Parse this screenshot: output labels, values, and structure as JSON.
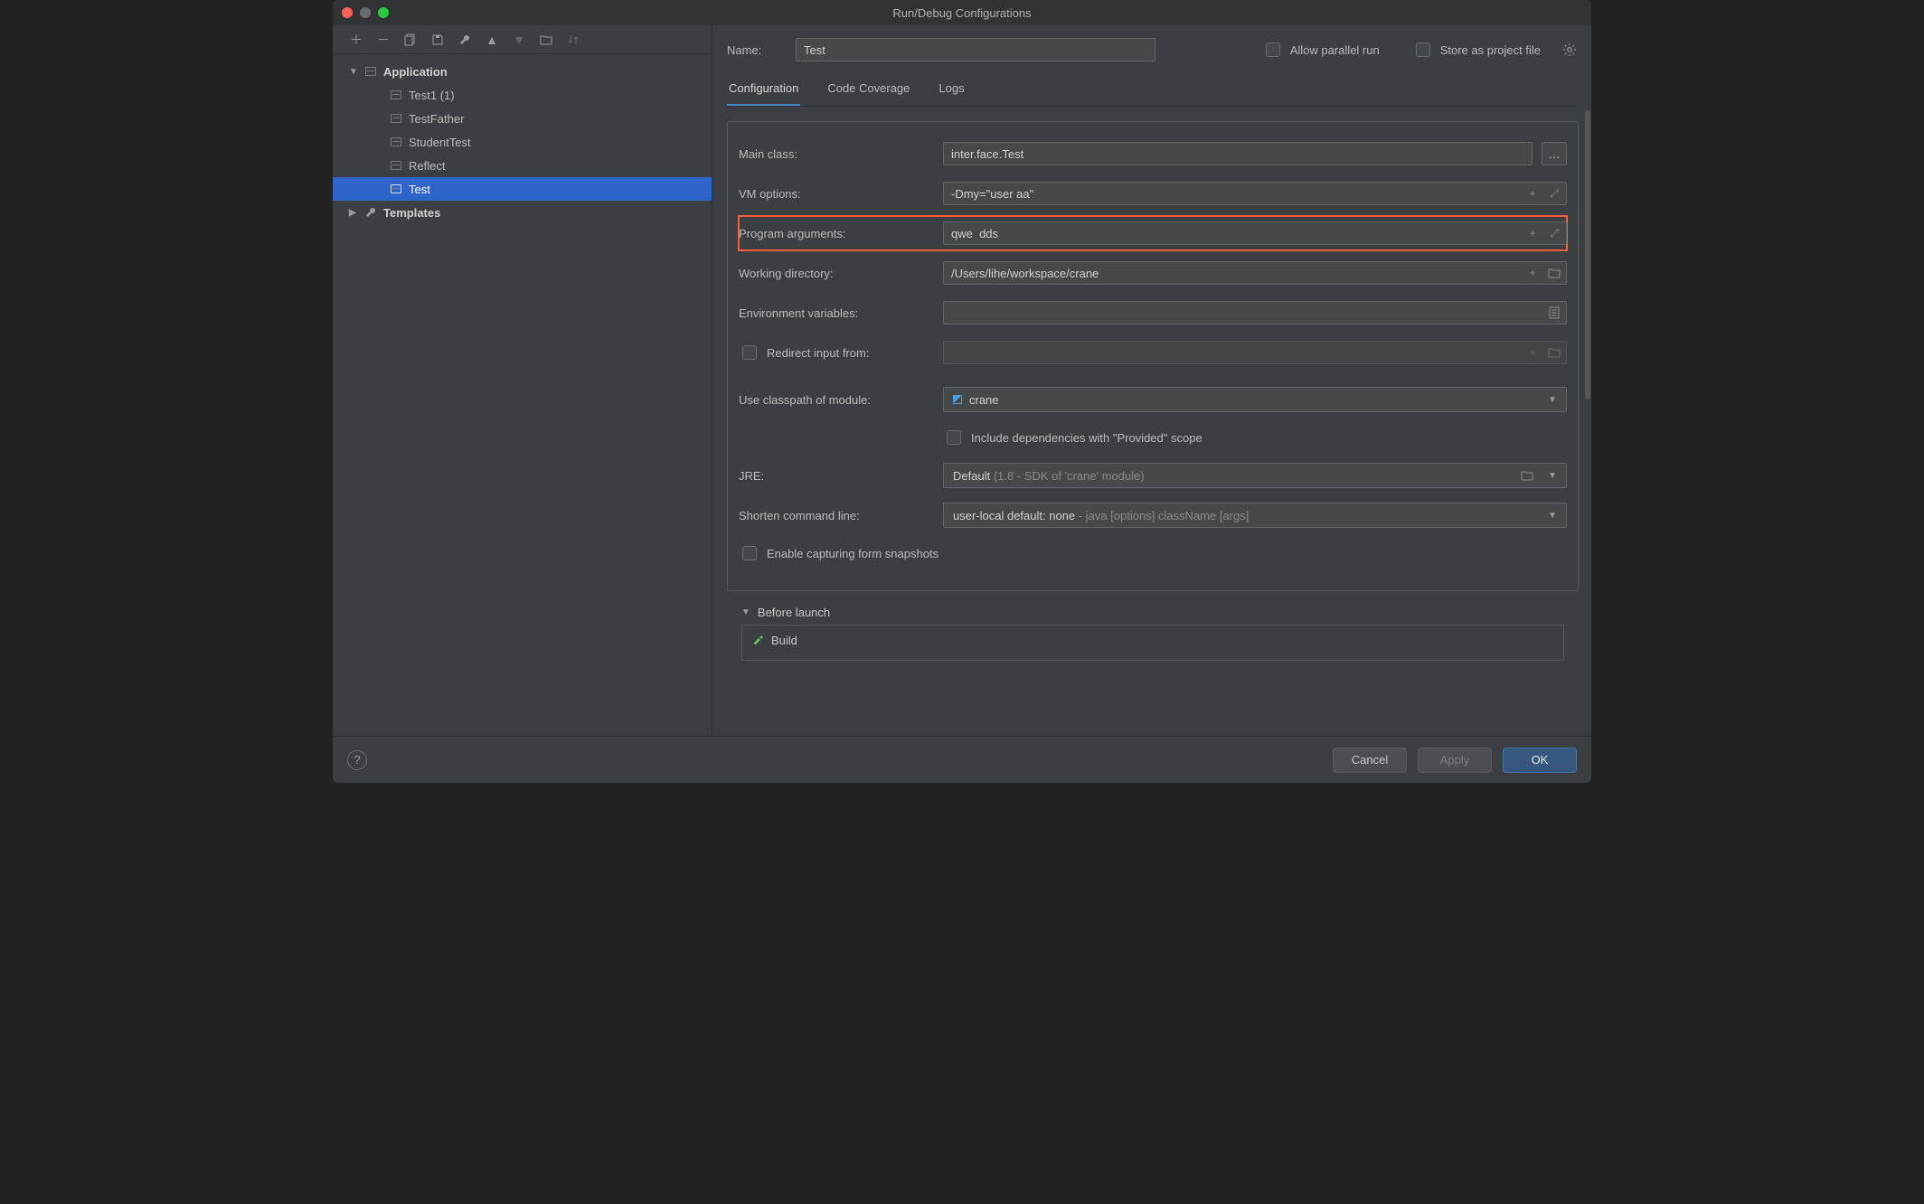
{
  "window": {
    "title": "Run/Debug Configurations"
  },
  "sidebar": {
    "groups": [
      {
        "label": "Application",
        "expanded": true,
        "items": [
          {
            "label": "Test1 (1)"
          },
          {
            "label": "TestFather"
          },
          {
            "label": "StudentTest"
          },
          {
            "label": "Reflect"
          },
          {
            "label": "Test",
            "selected": true
          }
        ]
      },
      {
        "label": "Templates",
        "expanded": false
      }
    ]
  },
  "header": {
    "name_label": "Name:",
    "name_value": "Test",
    "allow_parallel": "Allow parallel run",
    "store_project": "Store as project file"
  },
  "tabs": [
    {
      "label": "Configuration",
      "active": true
    },
    {
      "label": "Code Coverage"
    },
    {
      "label": "Logs"
    }
  ],
  "form": {
    "main_class": {
      "label": "Main class:",
      "value": "inter.face.Test"
    },
    "vm_options": {
      "label": "VM options:",
      "value": "-Dmy=\"user aa\""
    },
    "program_args": {
      "label": "Program arguments:",
      "value": "qwe  dds"
    },
    "working_dir": {
      "label": "Working directory:",
      "value": "/Users/lihe/workspace/crane"
    },
    "env_vars": {
      "label": "Environment variables:",
      "value": ""
    },
    "redirect_input": {
      "label": "Redirect input from:",
      "value": ""
    },
    "classpath": {
      "label": "Use classpath of module:",
      "value": "crane"
    },
    "include_provided": "Include dependencies with \"Provided\" scope",
    "jre": {
      "label": "JRE:",
      "value": "Default",
      "hint": "(1.8 - SDK of 'crane' module)"
    },
    "shorten": {
      "label": "Shorten command line:",
      "value": "user-local default: none",
      "hint": "- java [options] className [args]"
    },
    "capture_snapshots": "Enable capturing form snapshots"
  },
  "before_launch": {
    "title": "Before launch",
    "items": [
      {
        "label": "Build"
      }
    ]
  },
  "footer": {
    "cancel": "Cancel",
    "apply": "Apply",
    "ok": "OK"
  }
}
